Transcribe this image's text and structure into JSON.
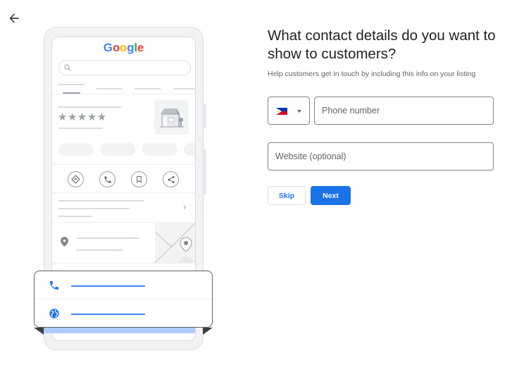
{
  "nav": {
    "back_icon": "arrow-left-icon"
  },
  "illustration": {
    "logo_letters": [
      "G",
      "o",
      "o",
      "g",
      "l",
      "e"
    ],
    "rating_stars": "★★★★★",
    "action_icons": [
      "directions-icon",
      "phone-icon",
      "bookmark-icon",
      "share-icon"
    ],
    "chevron": "›",
    "contact_card_icons": [
      "phone-icon",
      "globe-icon"
    ]
  },
  "form": {
    "title": "What contact details do you want to show to customers?",
    "subtitle": "Help customers get in touch by including this info on your listing",
    "country": {
      "selected": "Philippines",
      "flag_icon": "philippines-flag-icon"
    },
    "phone_placeholder": "Phone number",
    "phone_value": "",
    "website_placeholder": "Website (optional)",
    "website_value": "",
    "skip_label": "Skip",
    "next_label": "Next"
  },
  "colors": {
    "primary": "#1a73e8",
    "google_blue": "#4285f4",
    "google_red": "#ea4335",
    "google_yellow": "#fbbc05",
    "google_green": "#34a853"
  }
}
